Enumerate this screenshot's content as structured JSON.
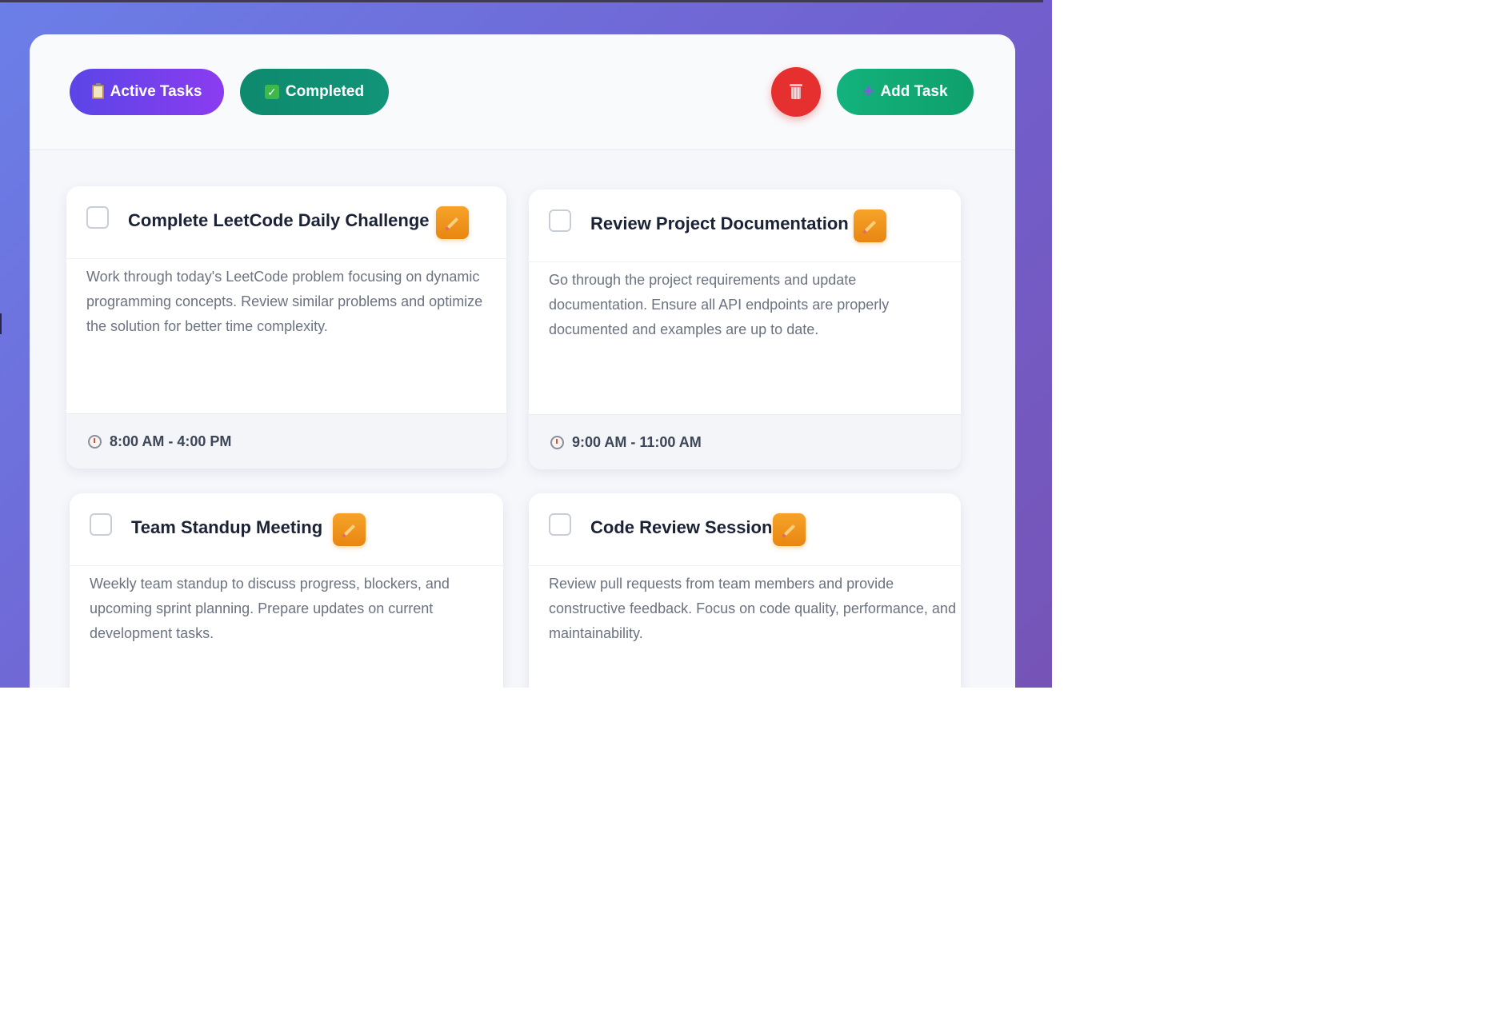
{
  "toolbar": {
    "active_label": "Active Tasks",
    "active_icon": "clipboard-icon",
    "completed_label": "Completed",
    "completed_icon": "check-box-icon",
    "delete_icon": "trash-icon",
    "add_label": "Add Task",
    "add_icon": "plus-icon"
  },
  "colors": {
    "background_gradient_start": "#6b7fe8",
    "background_gradient_end": "#7654b6",
    "active_pill": "#5b45e6",
    "completed_pill": "#0e8a6e",
    "add_pill": "#13b27c",
    "delete_button": "#e5302f",
    "edit_button": "#f6a32a"
  },
  "tasks": [
    {
      "title": "Complete LeetCode Daily Challenge",
      "description": "Work through today's LeetCode problem focusing on dynamic programming concepts. Review similar problems and optimize the solution for better time complexity.",
      "time": "8:00 AM - 4:00 PM",
      "checked": false
    },
    {
      "title": "Review Project Documentation",
      "description": "Go through the project requirements and update documentation. Ensure all API endpoints are properly documented and examples are up to date.",
      "time": "9:00 AM - 11:00 AM",
      "checked": false
    },
    {
      "title": "Team Standup Meeting",
      "description": "Weekly team standup to discuss progress, blockers, and upcoming sprint planning. Prepare updates on current development tasks.",
      "checked": false
    },
    {
      "title": "Code Review Session",
      "description": "Review pull requests from team members and provide constructive feedback. Focus on code quality, performance, and maintainability.",
      "checked": false
    }
  ]
}
